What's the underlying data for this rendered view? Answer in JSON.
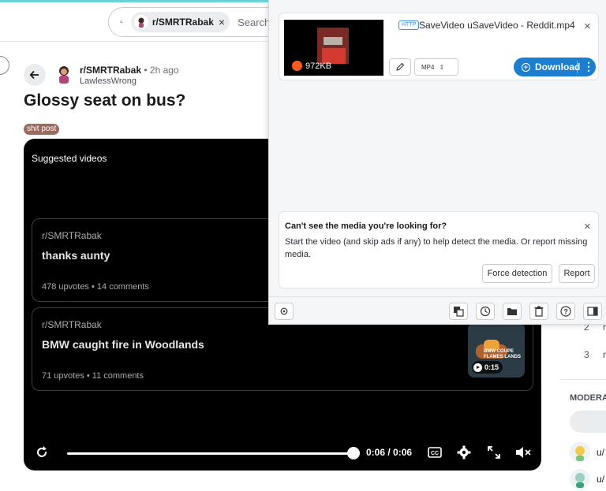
{
  "search": {
    "community_chip": "r/SMRTRabak",
    "chip_close": "×",
    "placeholder": "Search in"
  },
  "post": {
    "subreddit": "r/SMRTRabak",
    "separator": " • ",
    "time_ago": "2h ago",
    "author": "LawlessWrong",
    "title": "Glossy seat on bus?",
    "flair": "shit post"
  },
  "player": {
    "suggested_heading": "Suggested videos",
    "suggestions": [
      {
        "subreddit": "r/SMRTRabak",
        "title": "thanks aunty",
        "meta": "478 upvotes • 14 comments"
      },
      {
        "subreddit": "r/SMRTRabak",
        "title": "BMW caught fire in Woodlands",
        "meta": "71 upvotes • 11 comments",
        "thumb_caption": "BMW COUPE FLAMES LANDS",
        "thumb_duration": "0:15"
      }
    ],
    "progress": 1.0,
    "timecode": "0:06 / 0:06"
  },
  "sidebar": {
    "rank_numbers": [
      "2",
      "3"
    ],
    "rank_chars": [
      "r",
      "r"
    ],
    "moderators_heading": "MODERAT",
    "mod_users": [
      "u/",
      "u/"
    ]
  },
  "extension": {
    "media": {
      "badge": "HTTP",
      "filename": "SaveVideo uSaveVideo - Reddit.mp4",
      "size": "972KB",
      "format": "MP4",
      "download_label": "Download"
    },
    "notice": {
      "title": "Can't see the media you're looking for?",
      "body": "Start the video (and skip ads if any) to help detect the media. Or report missing media.",
      "force_label": "Force detection",
      "report_label": "Report"
    },
    "toolbar_icons": [
      "settings-icon",
      "translate-icon",
      "history-icon",
      "folder-icon",
      "trash-icon",
      "help-icon",
      "sidebar-icon"
    ]
  },
  "colors": {
    "accent_teal": "#6ad3d3",
    "download_blue": "#1b7ed0",
    "flair_brown": "#9a6a5f"
  }
}
